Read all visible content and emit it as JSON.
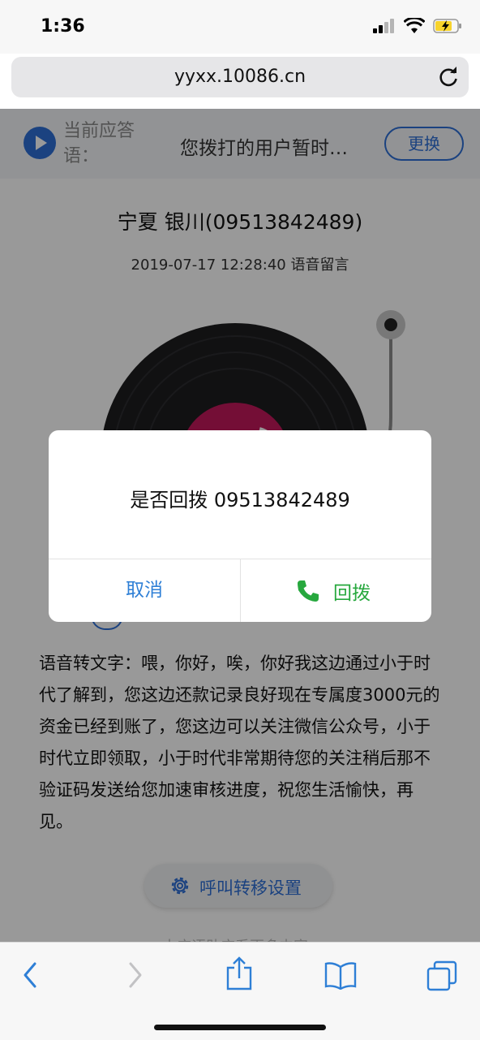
{
  "status_bar": {
    "time": "1:36",
    "battery_color": "#f7d32c"
  },
  "browser": {
    "url": "yyxx.10086.cn",
    "icons": [
      "reload-icon",
      "back-icon",
      "forward-icon",
      "share-icon",
      "bookmarks-icon",
      "tabs-icon"
    ]
  },
  "greeting": {
    "label": "当前应答语：",
    "text": "您拨打的用户暂时…",
    "change_label": "更换"
  },
  "message": {
    "caller": "宁夏 银川(09513842489)",
    "meta": "2019-07-17 12:28:40 语音留言",
    "transcript": "语音转文字：喂，你好，唉，你好我这边通过小于时代了解到，您这边还款记录良好现在专属度3000元的资金已经到账了，您这边可以关注微信公众号，小于时代立即领取，小于时代非常期待您的关注稍后那不验证码发送给您加速审核进度，祝您生活愉快，再见。"
  },
  "settings": {
    "label": "呼叫转移设置"
  },
  "footer": {
    "faded_text": "本应语助应系更多内容"
  },
  "dialog": {
    "message": "是否回拨 09513842489",
    "cancel_label": "取消",
    "callback_label": "回拨",
    "accent_blue": "#2e7fd6",
    "accent_green": "#27a83e"
  }
}
